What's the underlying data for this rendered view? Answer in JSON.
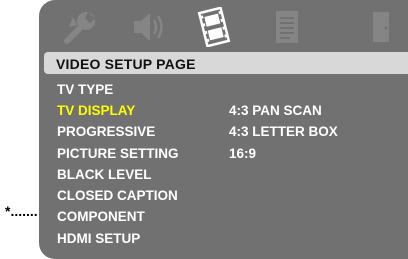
{
  "tabs": [
    {
      "name": "General Setup",
      "icon": "wrench-icon"
    },
    {
      "name": "Audio Setup",
      "icon": "speaker-icon"
    },
    {
      "name": "Video Setup",
      "icon": "film-icon",
      "selected": true
    },
    {
      "name": "Preference",
      "icon": "document-icon"
    },
    {
      "name": "Exit",
      "icon": "door-icon"
    }
  ],
  "page_title": "VIDEO SETUP PAGE",
  "menu_items": [
    {
      "label": "TV TYPE"
    },
    {
      "label": "TV DISPLAY",
      "highlighted": true
    },
    {
      "label": "PROGRESSIVE"
    },
    {
      "label": "PICTURE SETTING"
    },
    {
      "label": "BLACK LEVEL"
    },
    {
      "label": "CLOSED CAPTION"
    },
    {
      "label": "COMPONENT"
    },
    {
      "label": "HDMI SETUP"
    }
  ],
  "options": [
    "4:3 PAN SCAN",
    "4:3 LETTER BOX",
    "16:9"
  ],
  "marker": "*.......",
  "colors": {
    "panel": "#717171",
    "header_bar": "#d8d8d8",
    "highlight_text": "#ffff00",
    "text": "#ffffff",
    "selected_icon": "#ffffff",
    "unselected_icon": "#858585"
  }
}
